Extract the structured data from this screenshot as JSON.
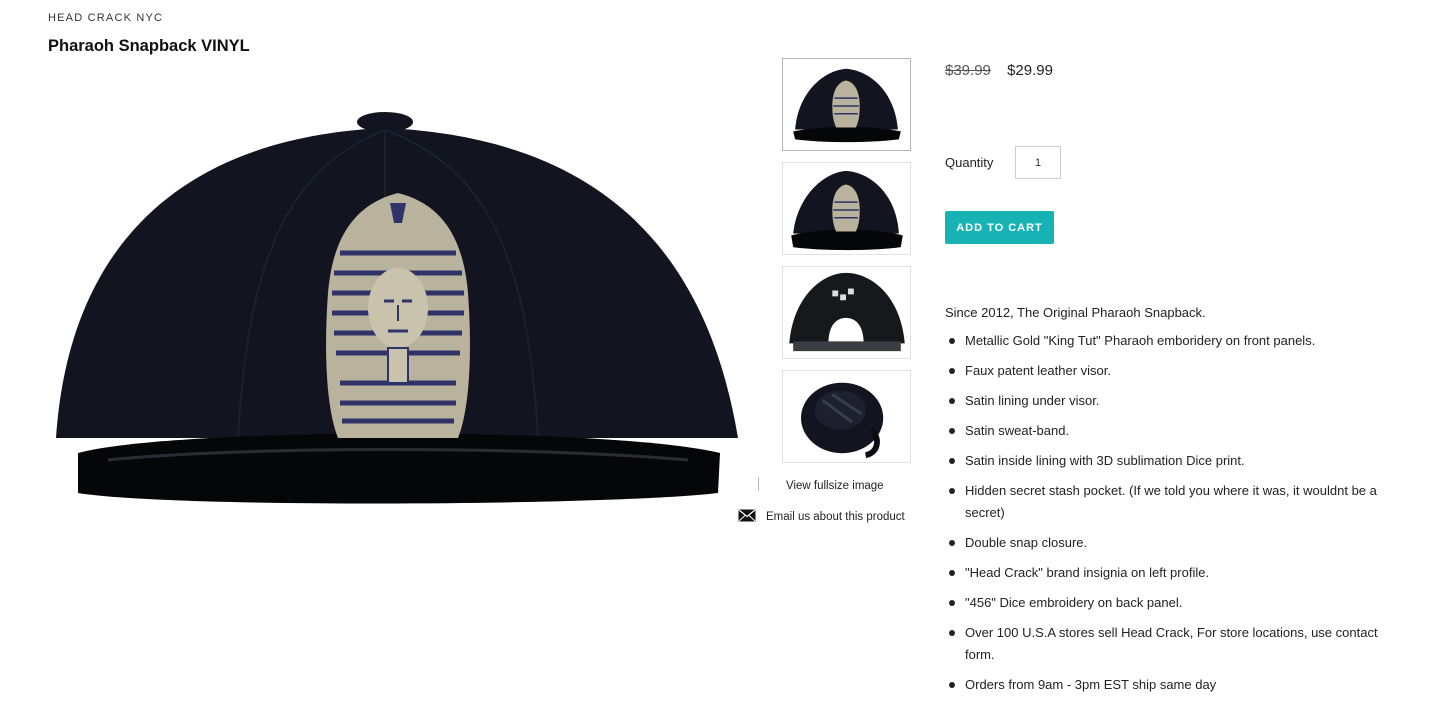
{
  "product": {
    "vendor": "HEAD CRACK NYC",
    "title": "Pharaoh Snapback VINYL",
    "old_price": "$39.99",
    "price": "$29.99",
    "quantity_label": "Quantity",
    "quantity_value": "1",
    "add_to_cart_label": "ADD TO CART"
  },
  "gallery": {
    "main_image_alt": "Pharaoh Snapback VINYL",
    "thumbnails": [
      "Front view",
      "Front angle view",
      "Back view",
      "Underside view"
    ],
    "view_fullsize_label": "View fullsize image",
    "email_label": "Email us about this product"
  },
  "description": {
    "intro": "Since 2012, The Original Pharaoh Snapback.",
    "bullets": [
      "Metallic Gold \"King Tut\" Pharaoh emboridery on front panels.",
      "Faux patent leather visor.",
      "Satin lining under visor.",
      "Satin sweat-band.",
      "Satin inside lining with 3D sublimation Dice print.",
      "Hidden secret stash pocket. (If we told you where it was, it wouldnt be a secret)",
      "Double snap closure.",
      "\"Head Crack\" brand insignia on left profile.",
      "\"456\" Dice embroidery on back panel.",
      "Over 100 U.S.A stores sell Head Crack, For store locations, use contact form.",
      "Orders from 9am - 3pm EST ship same day"
    ]
  },
  "colors": {
    "accent": "#17b3b4",
    "cap": "#12141f",
    "embroidery_gold": "#b9b29d",
    "embroidery_navy": "#2f3468"
  }
}
